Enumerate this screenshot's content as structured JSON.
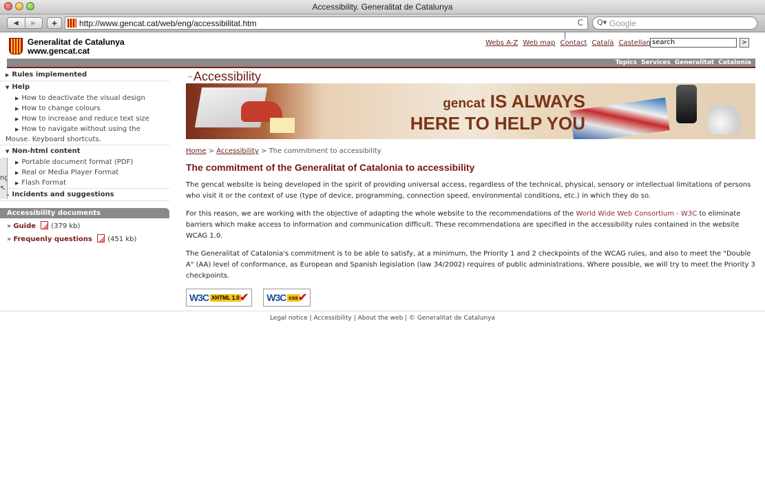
{
  "window": {
    "title": "Accessibility. Generalitat de Catalunya"
  },
  "browser": {
    "url": "http://www.gencat.cat/web/eng/accessibilitat.htm",
    "search_placeholder": "Google",
    "reload_glyph": "C"
  },
  "site": {
    "org_name": "Generalitat de Catalunya",
    "org_url": "www.gencat.cat",
    "top_links": [
      "Webs A-Z",
      "Web map",
      "Contact",
      "Català",
      "Castellano"
    ],
    "search_value": "search",
    "nav": [
      "Topics",
      "Services",
      "Generalitat",
      "Catalonia"
    ]
  },
  "sidebar": {
    "rules": "Rules implemented",
    "help": "Help",
    "help_items": [
      "How to deactivate the visual design",
      "How to change colours",
      "How to increase and reduce text size",
      "How to navigate without using the"
    ],
    "help_item_cont": "Mouse. Keyboard shortcuts.",
    "nonhtml": "Non-html content",
    "nonhtml_items": [
      "Portable document format (PDF)",
      "Real or Media Player Format",
      "Flash Format"
    ],
    "incidents": "Incidents and suggestions",
    "docs_title": "Accessibility documents",
    "doc_guide": "Guide",
    "doc_guide_size": "(379 kb)",
    "doc_faq": "Frequenly questions",
    "doc_faq_size": "(451 kb)",
    "frag_text": "ng"
  },
  "main": {
    "page_title": "Accessibility",
    "banner_line1_a": "gencat",
    "banner_line1_b": "IS ALWAYS",
    "banner_line2": "HERE TO HELP YOU",
    "crumb_home": "Home",
    "crumb_acc": "Accessibility",
    "crumb_current": "The commitment to accessibility",
    "heading": "The commitment of the Generalitat of Catalonia to accessibility",
    "p1": "The gencat website is being developed in the spirit of providing universal access, regardless of the technical, physical, sensory or intellectual limitations of persons who visit it or the context of use (type of device, programming, connection speed, environmental conditions, etc.) in which they do so.",
    "p2_a": "For this reason, we are working with the objective of adapting the whole website to the recommendations of the ",
    "p2_link": "World Wide Web Consortium - W3C",
    "p2_b": " to eliminate barriers which make access to information and communication difficult. These recommendations are specified in the accessibility rules contained in the website WCAG 1.0.",
    "p3": "The Generalitat of Catalonia's commitment is to be able to satisfy, at a minimum, the Priority 1 and 2 checkpoints of the WCAG rules, and also to meet the \"Double A\" (AA) level of conformance, as European and Spanish legislation (law 34/2002) requires of public administrations. Where possible, we will try to meet the Priority 3 checkpoints.",
    "badge1_w3c": "W3C",
    "badge1_tag": "XHTML 1.0",
    "badge2_w3c": "W3C",
    "badge2_tag": "css"
  },
  "footer": {
    "items": [
      "Legal notice",
      "Accessibility",
      "About the web",
      "© Generalitat de Catalunya"
    ]
  },
  "colors": {
    "accent": "#6b1a1a",
    "nav_bar": "#8a8a8a",
    "link": "#6b2020"
  }
}
